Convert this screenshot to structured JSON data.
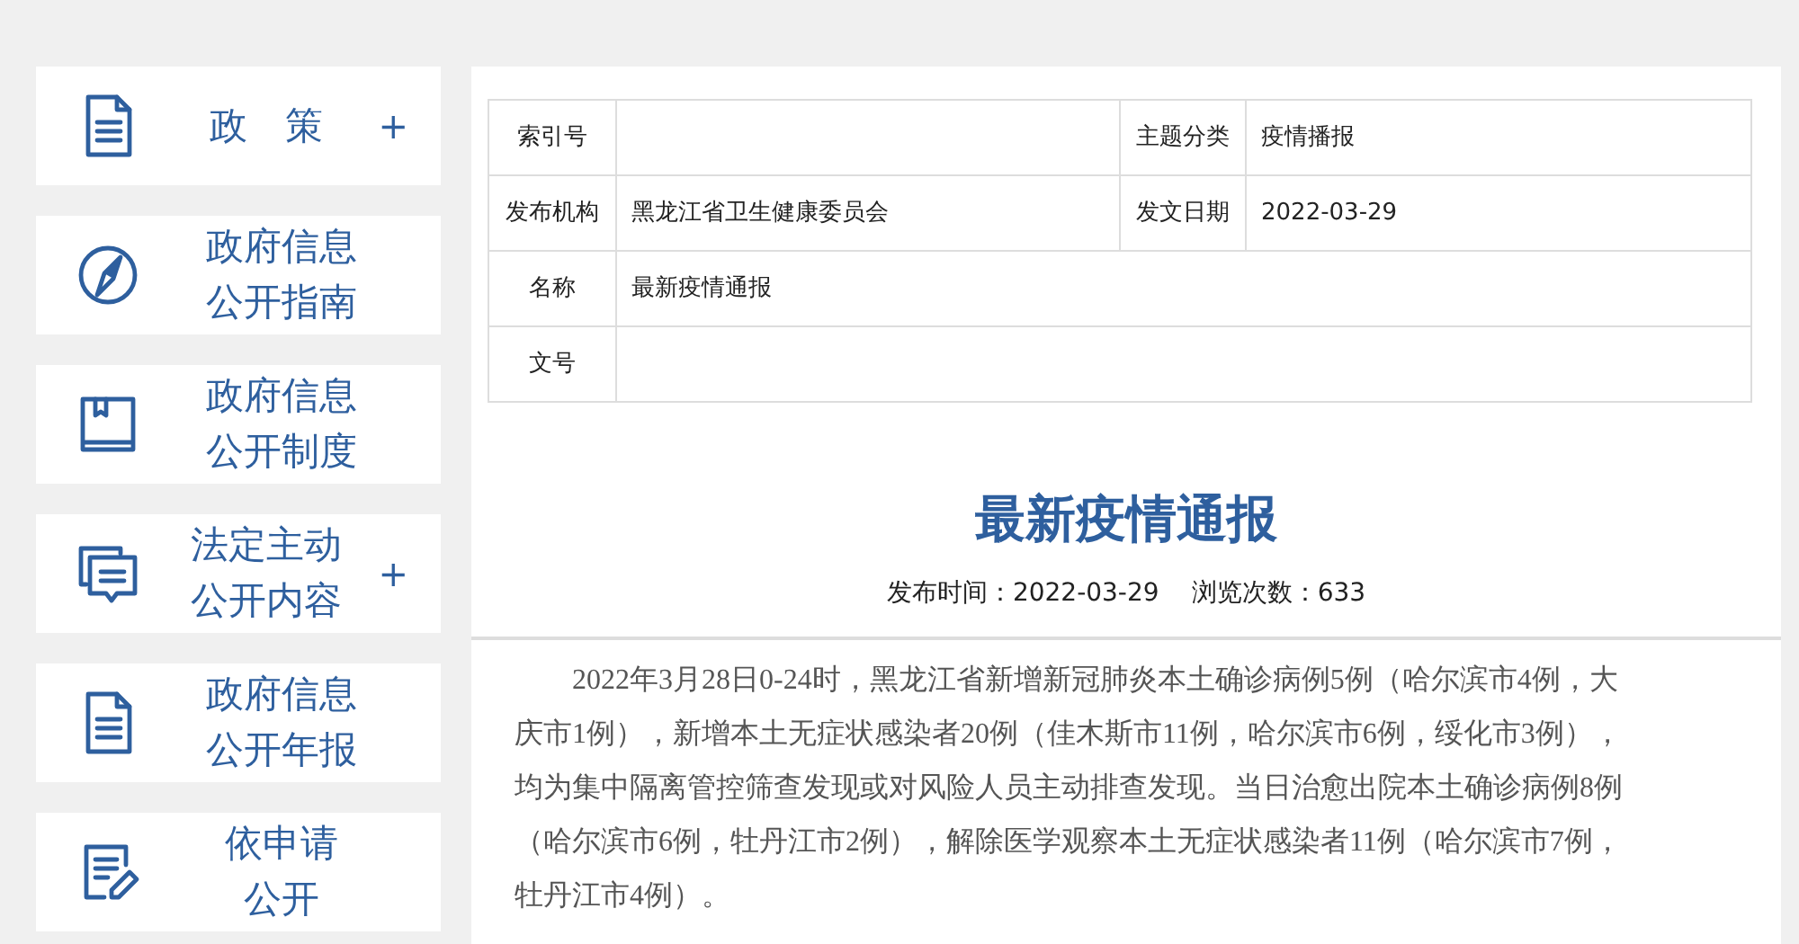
{
  "sidebar": {
    "items": [
      {
        "kind": "document",
        "lines": [
          "政　策"
        ],
        "plus": "+"
      },
      {
        "kind": "compass",
        "lines": [
          "政府信息",
          "公开指南"
        ]
      },
      {
        "kind": "book",
        "lines": [
          "政府信息",
          "公开制度"
        ]
      },
      {
        "kind": "chat",
        "lines": [
          "法定主动",
          "公开内容"
        ],
        "plus": "+"
      },
      {
        "kind": "document",
        "lines": [
          "政府信息",
          "公开年报"
        ]
      },
      {
        "kind": "edit",
        "lines": [
          "依申请",
          "公开"
        ]
      }
    ]
  },
  "info_table": {
    "rows": [
      [
        {
          "label": "索引号"
        },
        {
          "label": "主题分类",
          "value": "疫情播报"
        }
      ],
      [
        {
          "label": "发布机构",
          "value": "黑龙江省卫生健康委员会"
        },
        {
          "label": "发文日期",
          "value": "2022-03-29"
        }
      ],
      [
        {
          "label": "名称",
          "value": "最新疫情通报"
        }
      ],
      [
        {
          "label": "文号"
        }
      ]
    ]
  },
  "article": {
    "title": "最新疫情通报",
    "publish_time": "发布时间：2022-03-29",
    "views": "浏览次数：633",
    "paragraph": "2022年3月28日0-24时，黑龙江省新增新冠肺炎本土确诊病例5例（哈尔滨市4例，大庆市1例），新增本土无症状感染者20例（佳木斯市11例，哈尔滨市6例，绥化市3例），均为集中隔离管控筛查发现或对风险人员主动排查发现。当日治愈出院本土确诊病例8例（哈尔滨市6例，牡丹江市2例），解除医学观察本土无症状感染者11例（哈尔滨市7例，牡丹江市4例）。"
  }
}
